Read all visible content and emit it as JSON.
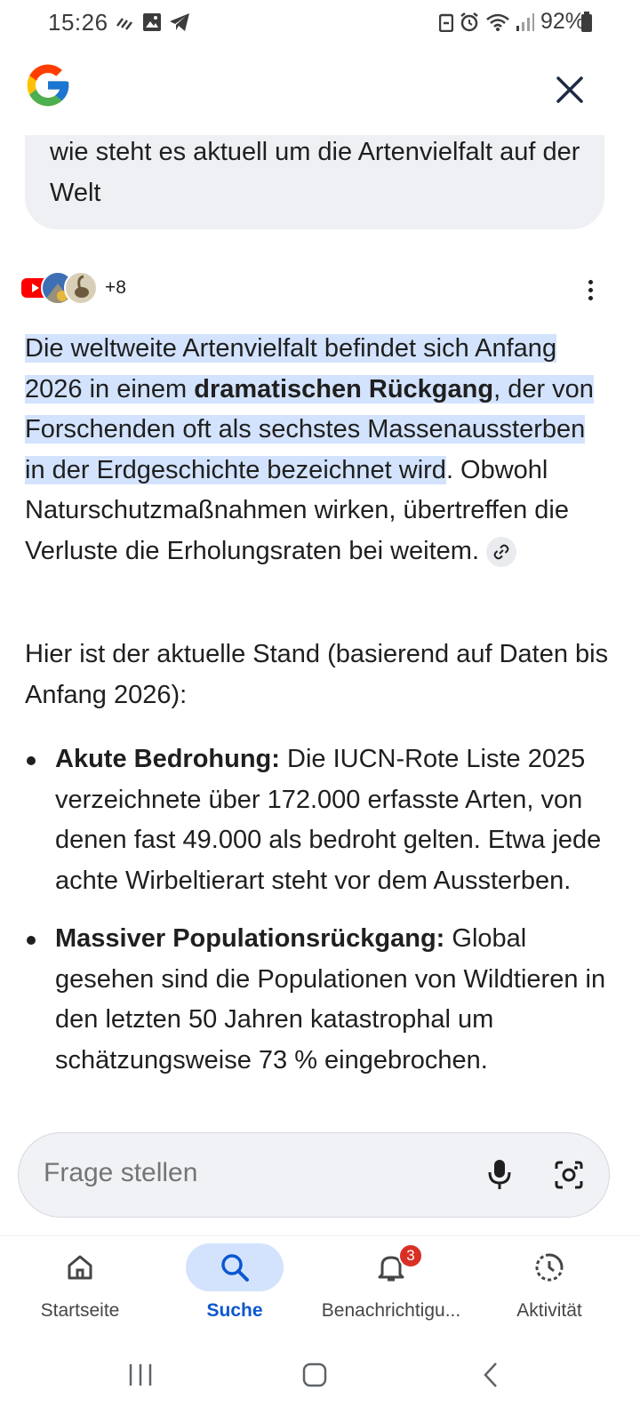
{
  "status_bar": {
    "time": "15:26",
    "battery": "92%"
  },
  "header": {
    "logo": "google-g-logo",
    "close_icon": "close-icon"
  },
  "query": {
    "text": "wie steht es aktuell um die Artenvielfalt auf der Welt"
  },
  "sources": {
    "count_label": "+8",
    "icons": [
      "youtube-icon",
      "news-source-icon",
      "bird-source-icon"
    ]
  },
  "answer": {
    "s1_a": " Die weltweite Artenvielfalt befindet sich Anfang 2026 in einem ",
    "s1_bold": "dramatischen Rückgang",
    "s1_b": ", der von Forschenden oft als sechstes Massenaussterben in der Erdgeschichte bezeichnet wird",
    "s2": ". Obwohl Naturschutzmaßnahmen wirken, übertreffen die Verluste die Erholungsraten bei weitem.",
    "para2": "Hier ist der aktuelle Stand (basierend auf Daten bis Anfang 2026):",
    "bullets": [
      {
        "title": "Akute Bedrohung:",
        "text": " Die IUCN-Rote Liste 2025 verzeichnete über 172.000 erfasste Arten, von denen fast 49.000 als bedroht gelten. Etwa jede achte Wirbeltierart steht vor dem Aussterben."
      },
      {
        "title": "Massiver Populationsrückgang:",
        "text": " Global gesehen sind die Populationen von Wildtieren in den letzten 50 Jahren katastrophal um schätzungsweise 73 % eingebrochen."
      }
    ]
  },
  "ask_bar": {
    "placeholder": "Frage stellen"
  },
  "bottom_nav": {
    "items": [
      {
        "label": "Startseite",
        "icon": "home-icon"
      },
      {
        "label": "Suche",
        "icon": "search-icon"
      },
      {
        "label": "Benachrichtigu...",
        "icon": "bell-icon",
        "badge": "3"
      },
      {
        "label": "Aktivität",
        "icon": "activity-icon"
      }
    ],
    "active": "Suche"
  },
  "colors": {
    "highlight": "#d3e3fd",
    "accent": "#0b57d0",
    "badge": "#d93025"
  }
}
